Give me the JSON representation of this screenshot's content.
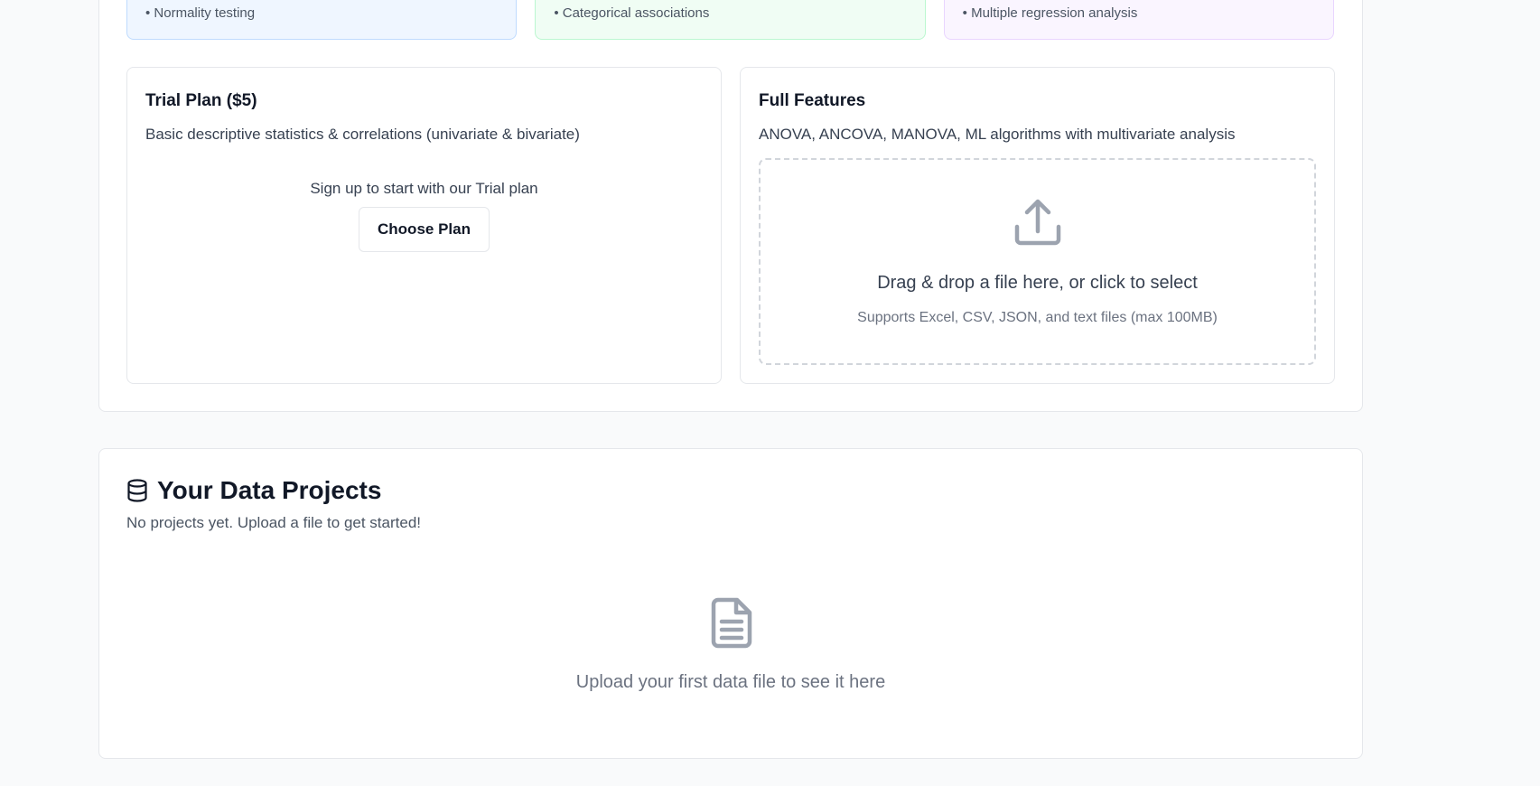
{
  "features": {
    "tiles": [
      {
        "text": "• Normality testing"
      },
      {
        "text": "• Categorical associations"
      },
      {
        "text": "• Multiple regression analysis"
      }
    ]
  },
  "trial_plan": {
    "title": "Trial Plan ($5)",
    "description": "Basic descriptive statistics & correlations (univariate & bivariate)",
    "signup_text": "Sign up to start with our Trial plan",
    "button_label": "Choose Plan"
  },
  "full_features": {
    "title": "Full Features",
    "description": "ANOVA, ANCOVA, MANOVA, ML algorithms with multivariate analysis",
    "dropzone": {
      "icon": "upload-icon",
      "main_text": "Drag & drop a file here, or click to select",
      "sub_text": "Supports Excel, CSV, JSON, and text files (max 100MB)"
    }
  },
  "projects": {
    "icon": "database-icon",
    "title": "Your Data Projects",
    "subtitle": "No projects yet. Upload a file to get started!",
    "empty_icon": "document-icon",
    "empty_text": "Upload your first data file to see it here"
  },
  "colors": {
    "icon_gray": "#9ca3af",
    "border": "#e5e7eb",
    "tile_blue": "#eff6ff",
    "tile_green": "#f0fdf4",
    "tile_purple": "#faf5ff"
  }
}
